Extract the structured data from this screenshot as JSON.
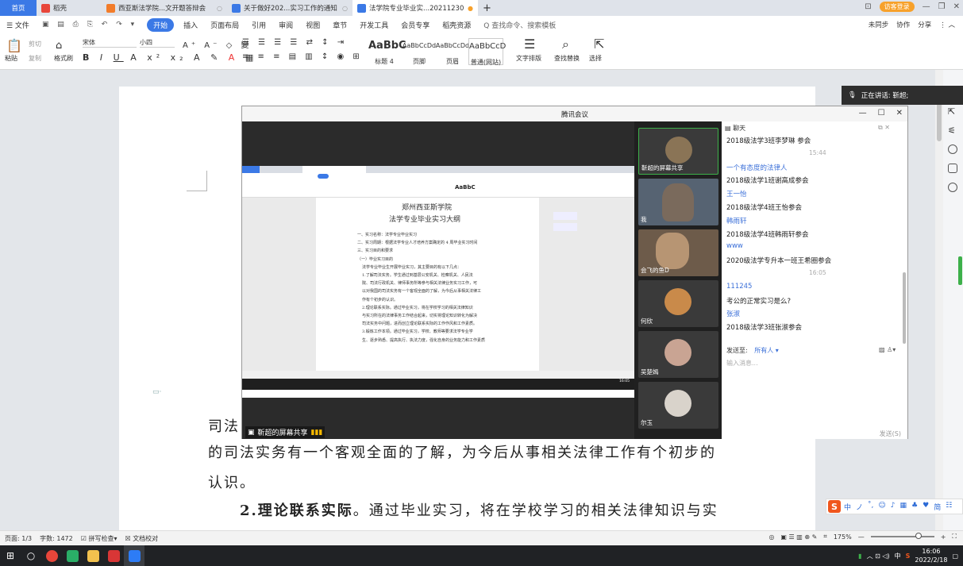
{
  "tabs": {
    "home": "首页",
    "items": [
      {
        "label": "稻壳",
        "color": "#e8463a"
      },
      {
        "label": "西亚斯法学院...文开题答辩会",
        "color": "#f27c2a"
      },
      {
        "label": "关于做好202...实习工作的通知",
        "color": "#3b79e6"
      },
      {
        "label": "法学院专业毕业实...20211230",
        "color": "#3b79e6"
      }
    ],
    "add": "+",
    "visitor": "访客登录"
  },
  "menu": {
    "file": "☰ 文件",
    "items": [
      "开始",
      "插入",
      "页面布局",
      "引用",
      "审阅",
      "视图",
      "章节",
      "开发工具",
      "会员专享",
      "稻壳资源"
    ],
    "search": "Q 查找命令、搜索模板",
    "right": [
      "未同步",
      "协作",
      "分享"
    ]
  },
  "ribbon": {
    "paste": "粘贴",
    "cut": "剪切",
    "copy": "复制",
    "format_painter": "格式刷",
    "font_name": "宋体",
    "font_size": "小四",
    "styles": [
      {
        "big": "AaBbC",
        "label": "标题 4"
      },
      {
        "big": "AaBbCcDd",
        "label": "页脚"
      },
      {
        "big": "AaBbCcDd",
        "label": "页眉"
      },
      {
        "big": "AaBbCcD",
        "label": "普通(网站)"
      }
    ],
    "text_layout": "文字排版",
    "find_replace": "查找替换",
    "select": "选择"
  },
  "doc": {
    "line1": "司法",
    "line2": "的司法实务有一个客观全面的了解，为今后从事相关法律工作有个初步的",
    "line3": "认识。",
    "line4_bold": "2.理论联系实际",
    "line4_rest": "。通过毕业实习，将在学校学习的相关法律知识与实"
  },
  "speaking": "正在讲话: 靳超;",
  "meeting": {
    "title": "腾讯会议",
    "share_label": "靳超的屏幕共享",
    "mini_doc": {
      "school": "郑州西亚斯学院",
      "title": "法学专业毕业实习大纲",
      "lines": [
        "一、实习名称：法学专业毕业实习",
        "二、实习周期：根据法学专业人才培养方案确定的 4 周毕业实习时间",
        "三、实习目的和要求",
        "（一）毕业实习目的",
        "法学专业毕业生开展毕业实习，其主要目的有以下几点：",
        "1.了解司法实务。学生通过到基层公安机关、检察机关、人民法",
        "院、司法行政机关、律师事务所等参与相关法律业务实习工作，可",
        "以对我国的司法实务有一个客观全面的了解，为今后从事相关法律工",
        "作有个初步的认识。",
        "2.理论联系实际。通过毕业实习，将在学校学习的相关法律知识",
        "与实习所在的法律事务工作结合起来，切实将理论知识转化为解决",
        "司法实务中问题，进而创立理论联系实际的工作作风和工作素质。",
        "3.锻炼工作本领。通过毕业实习，学校、教师等要求法学专业学",
        "生、逐步熟悉、提高执行、执法力度，强化自身的业务能力和工作素质"
      ],
      "clock": "16:05"
    },
    "participants": [
      {
        "name": "靳超的屏幕共享"
      },
      {
        "name": "我"
      },
      {
        "name": "会飞的鱼D"
      },
      {
        "name": "何欣"
      },
      {
        "name": "吴楚嫣"
      },
      {
        "name": "尔玉"
      }
    ],
    "chat": {
      "header": "聊天",
      "messages": [
        {
          "type": "text",
          "value": "2018级法学3班李梦琳 参会"
        },
        {
          "type": "time",
          "value": "15:44"
        },
        {
          "type": "name",
          "value": "一个有态度的法律人"
        },
        {
          "type": "text",
          "value": "2018级法学1班谢高成参会"
        },
        {
          "type": "name",
          "value": "王一怡"
        },
        {
          "type": "text",
          "value": "2018级法学4班王怡参会"
        },
        {
          "type": "name",
          "value": "韩雨轩"
        },
        {
          "type": "text",
          "value": "2018级法学4班韩雨轩参会"
        },
        {
          "type": "name",
          "value": "www"
        },
        {
          "type": "text",
          "value": "2020级法学专升本一班王希圈参会"
        },
        {
          "type": "time",
          "value": "16:05"
        },
        {
          "type": "name",
          "value": "111245"
        },
        {
          "type": "text",
          "value": "考公的正常实习是么?"
        },
        {
          "type": "name",
          "value": "张淑"
        },
        {
          "type": "text",
          "value": "2018级法学3班张淑参会"
        }
      ],
      "send_to_label": "发送至:",
      "send_to_value": "所有人",
      "input_placeholder": "输入消息...",
      "send_button": "发送(S)"
    }
  },
  "status": {
    "page": "页面: 1/3",
    "words": "字数: 1472",
    "spell": "拼写检查",
    "proof": "文档校对",
    "zoom": "175%"
  },
  "taskbar": {
    "time": "16:06",
    "date": "2022/2/18",
    "ime": "中"
  },
  "sogou": {
    "items": [
      "中",
      "ノ",
      "˚,",
      "☺",
      "♪",
      "▦",
      "♣",
      "♥",
      "简",
      "☷"
    ]
  }
}
